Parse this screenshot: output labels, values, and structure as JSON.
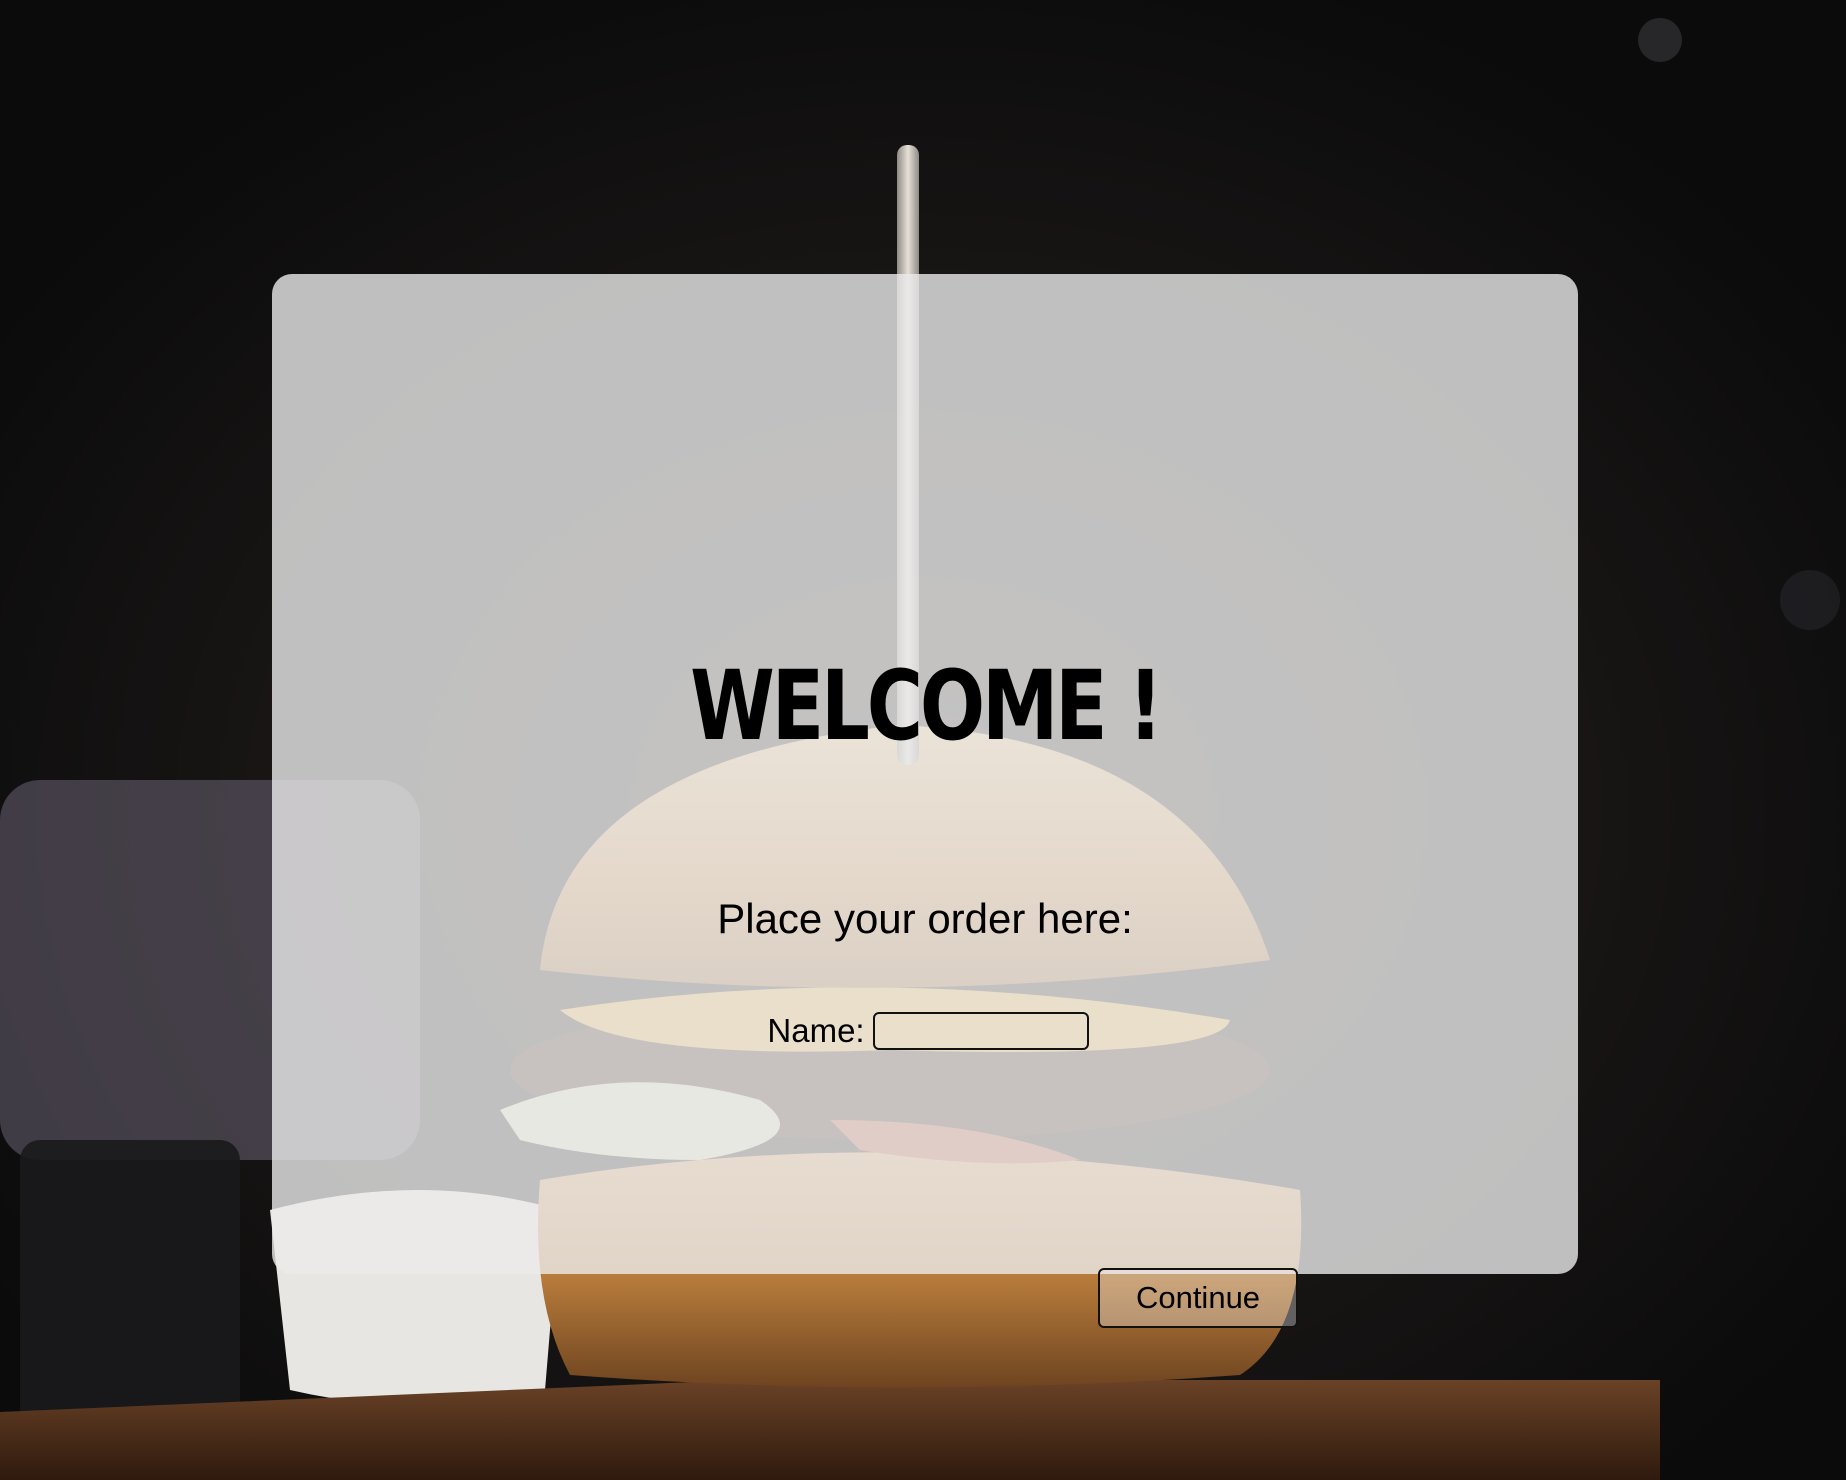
{
  "hero": {
    "title": "WELCOME !",
    "subtitle": "Place your order here:"
  },
  "order_form": {
    "name_label": "Name:",
    "name_value": "",
    "name_placeholder": "",
    "continue_label": "Continue"
  },
  "colors": {
    "page_background": "#0c0c0d",
    "card_background": "#ebebeb",
    "text": "#000000",
    "border": "#111111"
  },
  "background_image": "burger photo (dark restaurant scene, burger with skewer on wooden board)"
}
